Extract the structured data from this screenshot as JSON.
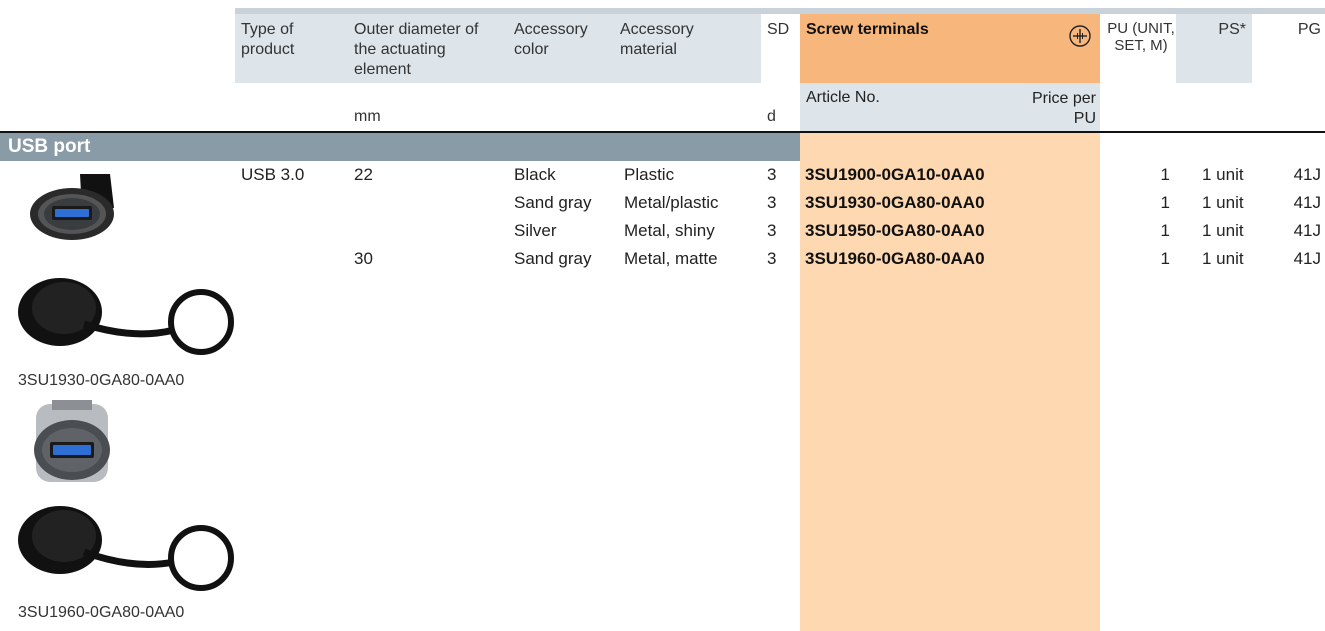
{
  "header": {
    "type_of_product": "Type of product",
    "outer_diameter": "Outer diameter of the actuating element",
    "accessory_color": "Accessory color",
    "accessory_material": "Accessory material",
    "sd": "SD",
    "screw_terminals": "Screw terminals",
    "pu": "PU (UNIT, SET, M)",
    "ps": "PS*",
    "pg": "PG",
    "article_no": "Article No.",
    "price_per_pu": "Price per PU",
    "unit_mm": "mm",
    "unit_d": "d",
    "screw_icon": "screw-terminal-icon"
  },
  "section": {
    "title": "USB port"
  },
  "rows": [
    {
      "type": "USB 3.0",
      "diameter": "22",
      "color": "Black",
      "material": "Plastic",
      "sd": "3",
      "article": "3SU1900-0GA10-0AA0",
      "pu": "1",
      "ps": "1 unit",
      "pg": "41J"
    },
    {
      "type": "",
      "diameter": "",
      "color": "Sand gray",
      "material": "Metal/plastic",
      "sd": "3",
      "article": "3SU1930-0GA80-0AA0",
      "pu": "1",
      "ps": "1 unit",
      "pg": "41J"
    },
    {
      "type": "",
      "diameter": "",
      "color": "Silver",
      "material": "Metal, shiny",
      "sd": "3",
      "article": "3SU1950-0GA80-0AA0",
      "pu": "1",
      "ps": "1 unit",
      "pg": "41J"
    },
    {
      "type": "",
      "diameter": "30",
      "color": "Sand gray",
      "material": "Metal, matte",
      "sd": "3",
      "article": "3SU1960-0GA80-0AA0",
      "pu": "1",
      "ps": "1 unit",
      "pg": "41J"
    }
  ],
  "images": [
    {
      "icon": "usb-port-22mm-icon",
      "caption": ""
    },
    {
      "icon": "usb-port-cap-icon",
      "caption": "3SU1930-0GA80-0AA0"
    },
    {
      "icon": "usb-port-30mm-icon",
      "caption": ""
    },
    {
      "icon": "usb-port-cap-icon",
      "caption": "3SU1960-0GA80-0AA0"
    }
  ],
  "colors": {
    "header_bg": "#dde4ea",
    "accent_orange": "#f7b77c",
    "column_orange": "#fdd8b0",
    "section_bg": "#8a9ba8"
  }
}
